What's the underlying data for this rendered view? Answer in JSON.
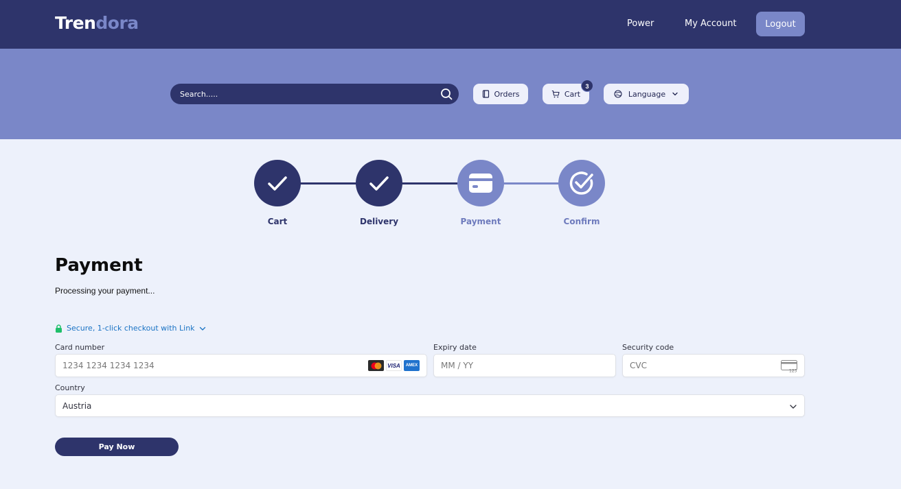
{
  "header": {
    "logo_part1": "Tren",
    "logo_part2": "dora",
    "nav": {
      "power": "Power",
      "account": "My Account",
      "logout": "Logout"
    }
  },
  "toolbar": {
    "search_placeholder": "Search.....",
    "orders": "Orders",
    "cart": "Cart",
    "cart_count": "3",
    "language": "Language"
  },
  "steps": [
    {
      "label": "Cart",
      "state": "done"
    },
    {
      "label": "Delivery",
      "state": "done"
    },
    {
      "label": "Payment",
      "state": "current"
    },
    {
      "label": "Confirm",
      "state": "todo"
    }
  ],
  "payment": {
    "title": "Payment",
    "status": "Processing your payment...",
    "link_text": "Secure, 1-click checkout with Link",
    "card_number": {
      "label": "Card number",
      "placeholder": "1234 1234 1234 1234"
    },
    "expiry": {
      "label": "Expiry date",
      "placeholder": "MM / YY"
    },
    "cvc": {
      "label": "Security code",
      "placeholder": "CVC"
    },
    "country": {
      "label": "Country",
      "value": "Austria"
    },
    "card_brands": [
      "mastercard",
      "VISA",
      "AMEX"
    ],
    "pay_button": "Pay Now"
  },
  "colors": {
    "navy": "#2e346b",
    "periwinkle": "#7a87c8",
    "background": "#edf1fb",
    "link": "#1a73c4",
    "secure_green": "#1fbf6a"
  }
}
